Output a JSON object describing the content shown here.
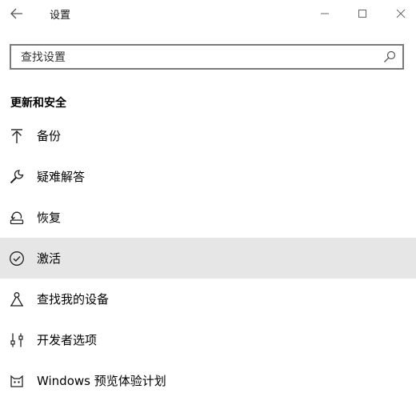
{
  "window": {
    "title": "设置",
    "back_icon": "back-arrow-icon",
    "controls": [
      "minimize-icon",
      "maximize-icon",
      "close-icon"
    ]
  },
  "search": {
    "placeholder": "查找设置",
    "value": "",
    "icon": "search-icon"
  },
  "section": {
    "title": "更新和安全"
  },
  "nav": {
    "items": [
      {
        "label": "备份",
        "icon": "backup-arrow-icon",
        "selected": false
      },
      {
        "label": "疑难解答",
        "icon": "wrench-icon",
        "selected": false
      },
      {
        "label": "恢复",
        "icon": "recovery-icon",
        "selected": false
      },
      {
        "label": "激活",
        "icon": "check-circle-icon",
        "selected": true
      },
      {
        "label": "查找我的设备",
        "icon": "find-device-icon",
        "selected": false
      },
      {
        "label": "开发者选项",
        "icon": "developer-options-icon",
        "selected": false
      },
      {
        "label": "Windows 预览体验计划",
        "icon": "insider-cat-icon",
        "selected": false
      }
    ]
  },
  "colors": {
    "selected_background": "#e6e6e6",
    "search_border": "#7a7a7a"
  }
}
